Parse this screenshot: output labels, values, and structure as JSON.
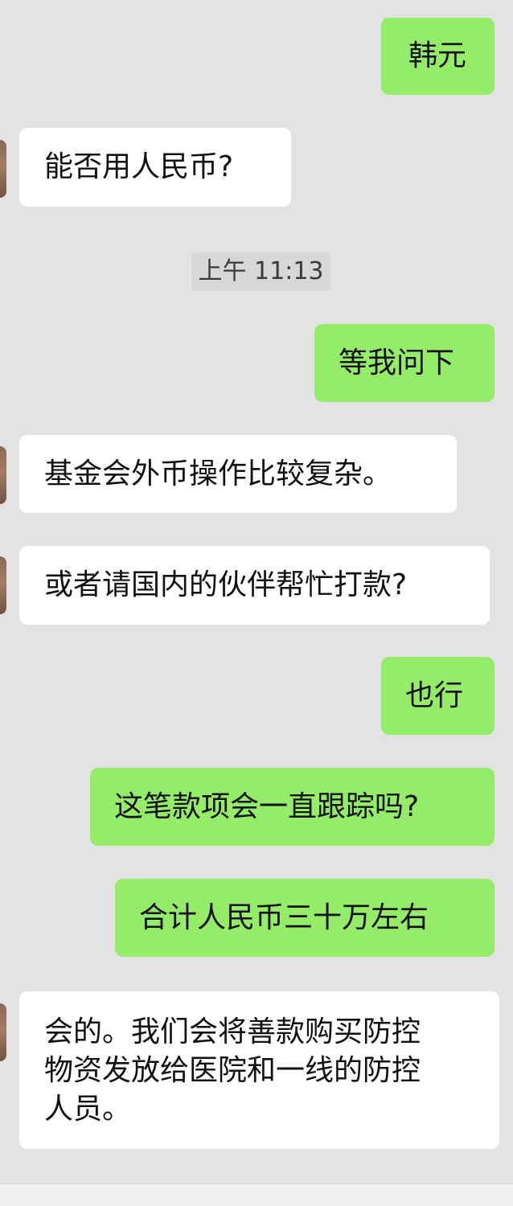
{
  "chat": {
    "timestamp": "上午 11:13",
    "messages": [
      {
        "direction": "sent",
        "text": "韩元"
      },
      {
        "direction": "received",
        "text": "能否用人民币?"
      },
      {
        "direction": "sent",
        "text": "等我问下"
      },
      {
        "direction": "received",
        "text": "基金会外币操作比较复杂。"
      },
      {
        "direction": "received",
        "text": "或者请国内的伙伴帮忙打款?"
      },
      {
        "direction": "sent",
        "text": "也行"
      },
      {
        "direction": "sent",
        "text": "这笔款项会一直跟踪吗?"
      },
      {
        "direction": "sent",
        "text": "合计人民币三十万左右"
      },
      {
        "direction": "received",
        "lines": [
          "会的。我们会将善款购买防控",
          "物资发放给医院和一线的防控",
          "人员。"
        ]
      }
    ]
  },
  "colors": {
    "background": "#e3e3e3",
    "sent_bubble": "#95ec69",
    "received_bubble": "#ffffff",
    "timestamp_pill": "#d7d7d7"
  }
}
